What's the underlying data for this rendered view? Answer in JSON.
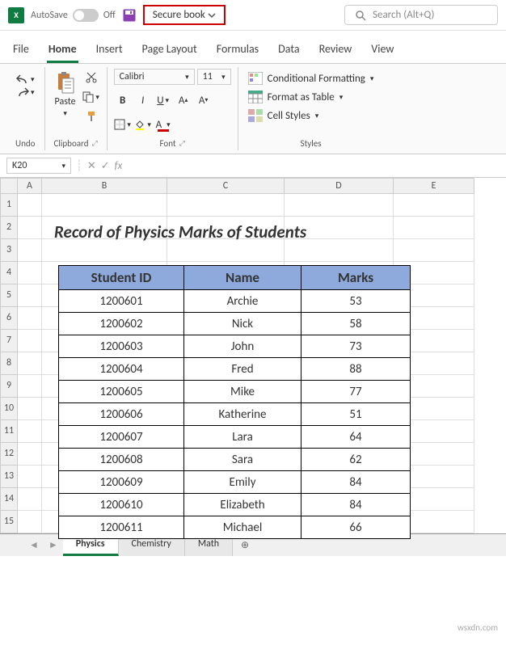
{
  "titlebar": {
    "autosave": "AutoSave",
    "autosave_state": "Off",
    "filename": "Secure book",
    "search_placeholder": "Search (Alt+Q)"
  },
  "tabs": [
    "File",
    "Home",
    "Insert",
    "Page Layout",
    "Formulas",
    "Data",
    "Review",
    "View"
  ],
  "active_tab": "Home",
  "ribbon": {
    "undo": "Undo",
    "paste": "Paste",
    "clipboard": "Clipboard",
    "font_name": "Calibri",
    "font_size": "11",
    "font": "Font",
    "conditional": "Conditional Formatting",
    "format_table": "Format as Table",
    "cell_styles": "Cell Styles",
    "styles": "Styles"
  },
  "name_box": "K20",
  "columns": [
    "A",
    "B",
    "C",
    "D",
    "E"
  ],
  "rows": [
    "1",
    "2",
    "3",
    "4",
    "5",
    "6",
    "7",
    "8",
    "9",
    "10",
    "11",
    "12",
    "13",
    "14",
    "15"
  ],
  "content": {
    "title": "Record of Physics Marks of Students",
    "headers": [
      "Student ID",
      "Name",
      "Marks"
    ],
    "data": [
      [
        "1200601",
        "Archie",
        "53"
      ],
      [
        "1200602",
        "Nick",
        "58"
      ],
      [
        "1200603",
        "John",
        "73"
      ],
      [
        "1200604",
        "Fred",
        "88"
      ],
      [
        "1200605",
        "Mike",
        "77"
      ],
      [
        "1200606",
        "Katherine",
        "51"
      ],
      [
        "1200607",
        "Lara",
        "64"
      ],
      [
        "1200608",
        "Sara",
        "62"
      ],
      [
        "1200609",
        "Emily",
        "84"
      ],
      [
        "1200610",
        "Elizabeth",
        "84"
      ],
      [
        "1200611",
        "Michael",
        "66"
      ]
    ]
  },
  "sheet_tabs": [
    "Physics",
    "Chemistry",
    "Math"
  ],
  "active_sheet": "Physics",
  "watermark": "wsxdn.com"
}
